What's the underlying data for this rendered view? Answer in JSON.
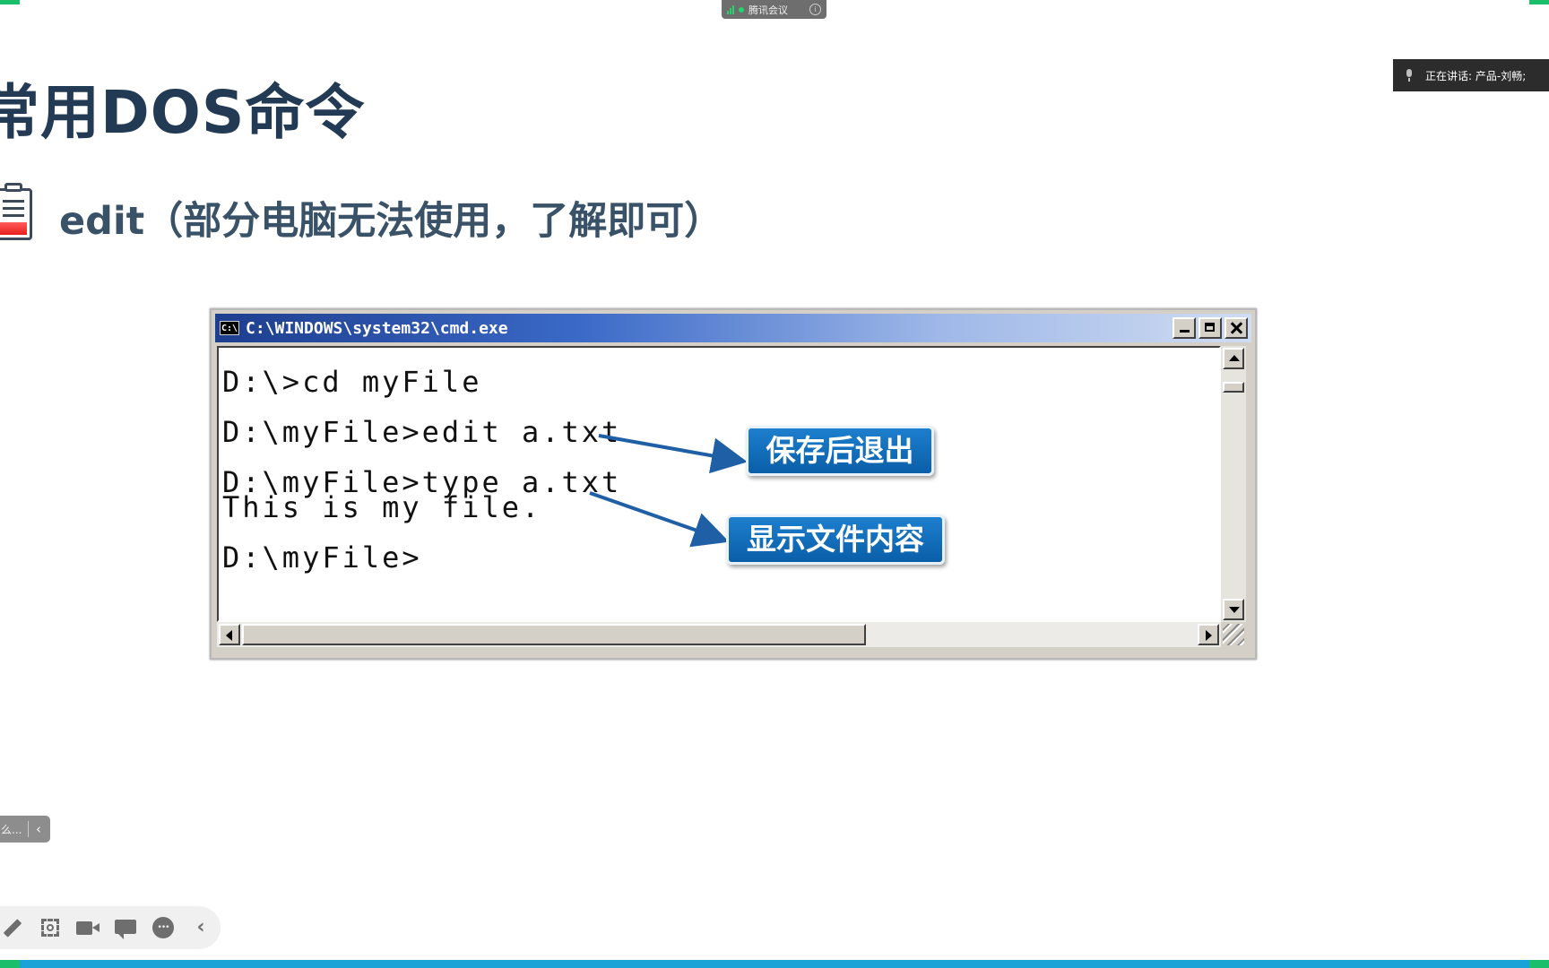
{
  "meeting": {
    "app_label": "腾讯会议",
    "speaking_label": "正在讲话: 产品-刘畅;"
  },
  "slide": {
    "title": "常用DOS命令",
    "subtitle": "edit（部分电脑无法使用，了解即可）"
  },
  "cmd_window": {
    "icon_text": "C:\\",
    "title": "C:\\WINDOWS\\system32\\cmd.exe",
    "lines": [
      "D:\\>cd myFile",
      "D:\\myFile>edit a.txt",
      "D:\\myFile>type a.txt",
      "This is my file.",
      "D:\\myFile>"
    ]
  },
  "callouts": {
    "save_exit": "保存后退出",
    "show_content": "显示文件内容"
  },
  "side_panel": {
    "text": "么...",
    "collapse": "‹"
  },
  "toolbar": {
    "collapse": "‹",
    "icons": [
      "pencil-icon",
      "screenshot-icon",
      "camera-icon",
      "chat-icon",
      "more-icon"
    ]
  },
  "colors": {
    "title": "#233a54",
    "callout_blue": "#0a5ea8",
    "accent_green": "#1bbf6b",
    "bottom_bar": "#1aa3d6"
  }
}
